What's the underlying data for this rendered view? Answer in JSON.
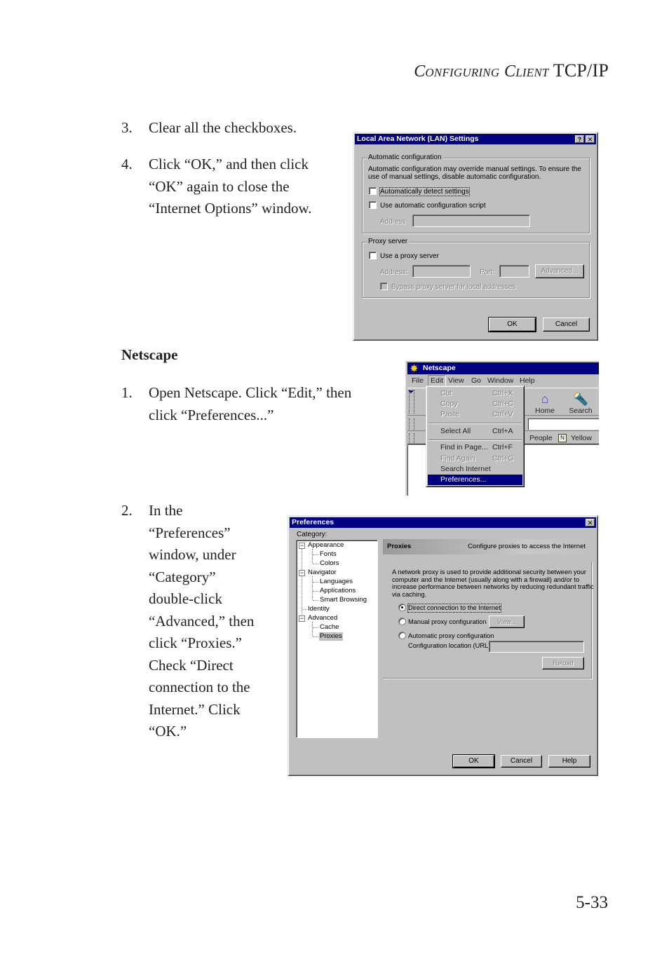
{
  "running_head": {
    "first_big": "C",
    "first_small": "onfiguring",
    "second_big": "C",
    "second_small": "lient",
    "rest": "TCP/IP"
  },
  "steps_lan": [
    {
      "num": "3.",
      "lines": [
        "Clear all the checkboxes."
      ]
    },
    {
      "num": "4.",
      "lines": [
        "Click “OK,” and then click",
        "“OK” again to close the",
        "“Internet Options” window."
      ]
    }
  ],
  "section_heading": "Netscape",
  "steps_netscape": [
    {
      "num": "1.",
      "lines": [
        "Open Netscape. Click “Edit,” then",
        "click “Preferences...”"
      ]
    },
    {
      "num": "2.",
      "lines": [
        "In the",
        "“Preferences”",
        "window, under",
        "“Category”",
        "double-click",
        "“Advanced,” then",
        "click “Proxies.”",
        "Check “Direct",
        "connection to the",
        "Internet.” Click",
        "“OK.”"
      ]
    }
  ],
  "page_number": "5-33",
  "lan_dialog": {
    "title": "Local Area Network (LAN) Settings",
    "help_icon": "?",
    "close_icon": "✕",
    "auto_group": {
      "legend": "Automatic configuration",
      "description_lines": [
        "Automatic configuration may override manual settings.  To ensure the",
        "use of manual settings, disable automatic configuration."
      ],
      "auto_detect": {
        "label": "Automatically detect settings",
        "checked": false
      },
      "use_script": {
        "label": "Use automatic configuration script",
        "checked": false
      },
      "address_label": "Address",
      "address_value": ""
    },
    "proxy_group": {
      "legend": "Proxy server",
      "use_proxy": {
        "label": "Use a proxy server",
        "checked": false
      },
      "address_label": "Address:",
      "address_value": "",
      "port_label": "Port:",
      "port_value": "",
      "advanced_label": "Advanced...",
      "bypass": {
        "label": "Bypass proxy server for local addresses",
        "checked": false
      }
    },
    "ok_label": "OK",
    "cancel_label": "Cancel"
  },
  "netscape": {
    "title": "Netscape",
    "menubar": [
      "File",
      "Edit",
      "View",
      "Go",
      "Window",
      "Help"
    ],
    "toolbar": [
      {
        "label": "Home",
        "icon": "home-icon"
      },
      {
        "label": "Search",
        "icon": "search-icon"
      }
    ],
    "personal_bar": [
      "People",
      "Yellow Pa"
    ],
    "edit_menu": [
      {
        "label": "Cut",
        "shortcut": "Ctrl+X",
        "enabled": false
      },
      {
        "label": "Copy",
        "shortcut": "Ctrl+C",
        "enabled": false
      },
      {
        "label": "Paste",
        "shortcut": "Ctrl+V",
        "enabled": false
      },
      {
        "label": "Select All",
        "shortcut": "Ctrl+A",
        "enabled": true
      },
      {
        "label": "Find in Page...",
        "shortcut": "Ctrl+F",
        "enabled": true
      },
      {
        "label": "Find Again",
        "shortcut": "Ctrl+G",
        "enabled": false
      },
      {
        "label": "Search Internet",
        "shortcut": "",
        "enabled": true
      },
      {
        "label": "Preferences...",
        "shortcut": "",
        "enabled": true,
        "selected": true
      }
    ]
  },
  "preferences": {
    "title": "Preferences",
    "close_icon": "✕",
    "category_label": "Category:",
    "tree": [
      {
        "label": "Appearance",
        "level": 0,
        "expanded": true
      },
      {
        "label": "Fonts",
        "level": 1
      },
      {
        "label": "Colors",
        "level": 1
      },
      {
        "label": "Navigator",
        "level": 0,
        "expanded": true
      },
      {
        "label": "Languages",
        "level": 1
      },
      {
        "label": "Applications",
        "level": 1
      },
      {
        "label": "Smart Browsing",
        "level": 1
      },
      {
        "label": "Identity",
        "level": 0
      },
      {
        "label": "Advanced",
        "level": 0,
        "expanded": true
      },
      {
        "label": "Cache",
        "level": 1
      },
      {
        "label": "Proxies",
        "level": 1,
        "selected": true
      }
    ],
    "header_title": "Proxies",
    "header_desc": "Configure proxies to access the Internet",
    "description_lines": [
      "A network proxy is used to provide additional security between your",
      "computer and the Internet (usually along with a firewall) and/or to",
      "increase performance between networks by reducing redundant traffic",
      "via caching."
    ],
    "options": [
      {
        "label": "Direct connection to the Internet",
        "selected": true
      },
      {
        "label": "Manual proxy configuration",
        "selected": false
      },
      {
        "label": "Automatic proxy configuration",
        "selected": false
      }
    ],
    "view_label": "View...",
    "config_url_label": "Configuration location (URL):",
    "config_url_value": "",
    "reload_label": "Reload",
    "ok_label": "OK",
    "cancel_label": "Cancel",
    "help_label": "Help"
  }
}
